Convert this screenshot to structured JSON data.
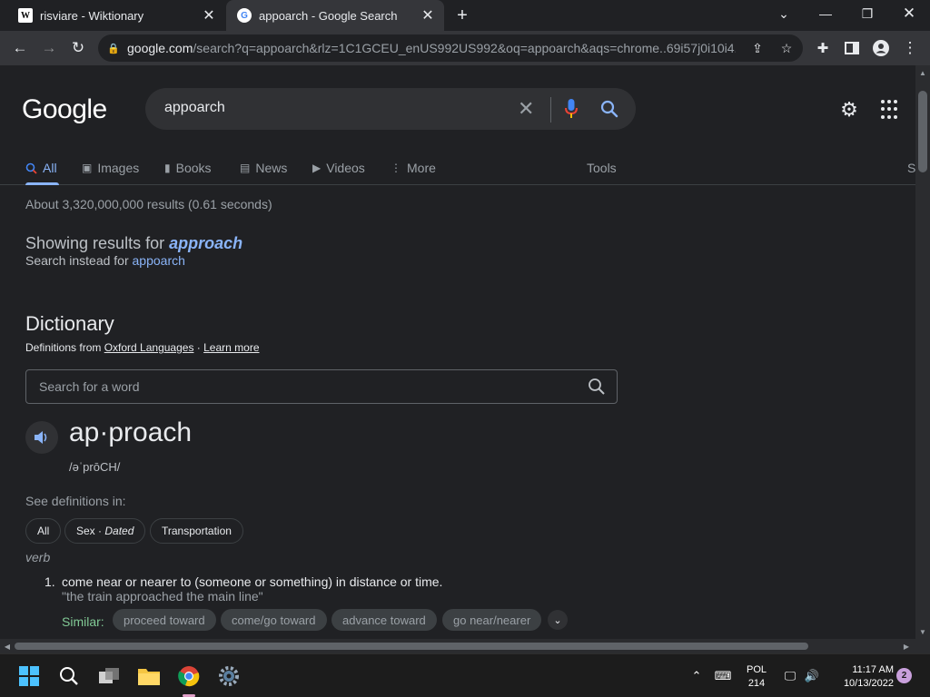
{
  "browser": {
    "tabs": [
      {
        "title": "risviare - Wiktionary",
        "favicon": "W"
      },
      {
        "title": "appoarch - Google Search",
        "favicon": "G"
      }
    ],
    "url_host": "google.com",
    "url_rest": "/search?q=appoarch&rlz=1C1GCEU_enUS992US992&oq=appoarch&aqs=chrome..69i57j0i10i4..."
  },
  "google": {
    "logo": "Google",
    "query": "appoarch",
    "nav": {
      "all": "All",
      "images": "Images",
      "books": "Books",
      "news": "News",
      "videos": "Videos",
      "more": "More",
      "tools": "Tools",
      "clipped": "S"
    },
    "stats": "About 3,320,000,000 results (0.61 seconds)",
    "showing_prefix": "Showing results for ",
    "showing_term": "approach",
    "instead_prefix": "Search instead for ",
    "instead_term": "appoarch"
  },
  "dictionary": {
    "title": "Dictionary",
    "from_prefix": "Definitions from ",
    "source": "Oxford Languages",
    "separator": " · ",
    "learn_more": "Learn more",
    "search_placeholder": "Search for a word",
    "headword": "ap·proach",
    "phonetic": "/əˈprōCH/",
    "see_definitions": "See definitions in:",
    "chips": {
      "all": "All",
      "sex": "Sex · ",
      "sex_dated": "Dated",
      "transportation": "Transportation"
    },
    "part_of_speech": "verb",
    "definition_number": "1.",
    "definition": "come near or nearer to (someone or something) in distance or time.",
    "example": "\"the train approached the main line\"",
    "similar_label": "Similar:",
    "similar": [
      "proceed toward",
      "come/go toward",
      "advance toward",
      "go near/nearer"
    ]
  },
  "taskbar": {
    "language_line1": "POL",
    "language_line2": "214",
    "time": "11:17 AM",
    "date": "10/13/2022",
    "notifications": "2"
  }
}
